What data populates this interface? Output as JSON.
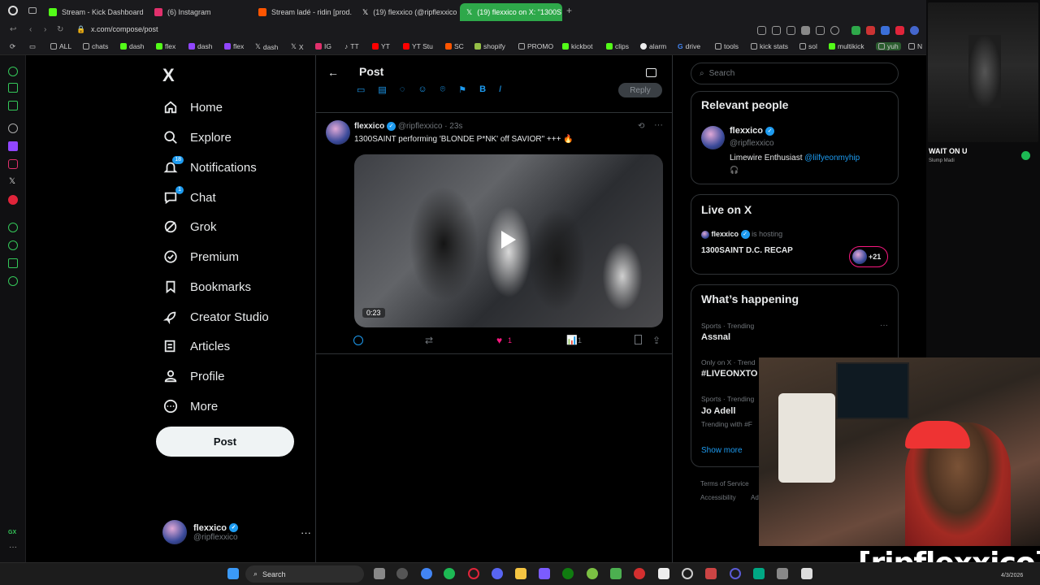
{
  "browser": {
    "tabs": [
      {
        "title": "Stream - Kick Dashboard",
        "favicon_color": "#53fc18",
        "active": false
      },
      {
        "title": "(6) Instagram",
        "favicon_color": "#e1306c",
        "active": false
      },
      {
        "title": "Stream ladé - ridin [prod.",
        "favicon_color": "#ff5500",
        "active": false
      },
      {
        "title": "(19) flexxico (@ripflexxico",
        "favicon_color": "#ffffff",
        "active": false
      },
      {
        "title": "(19) flexxico on X: \"1300S",
        "favicon_color": "#ffffff",
        "active": true
      }
    ],
    "new_tab_label": "+",
    "url": "x.com/compose/post",
    "bookmarks": [
      {
        "label": "ALL",
        "icon": "folder-icon"
      },
      {
        "label": "chats",
        "icon": "folder-icon"
      },
      {
        "label": "dash",
        "icon": "kick-icon"
      },
      {
        "label": "flex",
        "icon": "kick-icon"
      },
      {
        "label": "dash",
        "icon": "twitch-icon"
      },
      {
        "label": "flex",
        "icon": "twitch-icon"
      },
      {
        "label": "dash",
        "icon": "x-icon"
      },
      {
        "label": "X",
        "icon": "x-icon"
      },
      {
        "label": "IG",
        "icon": "instagram-icon"
      },
      {
        "label": "TT",
        "icon": "tiktok-icon"
      },
      {
        "label": "YT",
        "icon": "youtube-icon"
      },
      {
        "label": "YT Stu",
        "icon": "youtube-icon"
      },
      {
        "label": "SC",
        "icon": "soundcloud-icon"
      },
      {
        "label": "shopify",
        "icon": "shopify-icon"
      },
      {
        "label": "PROMO",
        "icon": "folder-icon"
      },
      {
        "label": "kickbot",
        "icon": "bot-icon"
      },
      {
        "label": "clips",
        "icon": "bot-icon"
      },
      {
        "label": "alarm",
        "icon": "alarm-icon"
      },
      {
        "label": "drive",
        "icon": "google-icon"
      },
      {
        "label": "tools",
        "icon": "folder-icon"
      },
      {
        "label": "kick stats",
        "icon": "folder-icon"
      },
      {
        "label": "sol",
        "icon": "folder-icon"
      },
      {
        "label": "multikick",
        "icon": "kick-icon"
      },
      {
        "label": "yuh",
        "icon": "folder-icon"
      },
      {
        "label": "N",
        "icon": "folder-icon"
      }
    ]
  },
  "nav": {
    "logo": "X",
    "items": [
      {
        "label": "Home",
        "icon": "home-icon",
        "badge": ""
      },
      {
        "label": "Explore",
        "icon": "search-icon",
        "badge": ""
      },
      {
        "label": "Notifications",
        "icon": "bell-icon",
        "badge": "18"
      },
      {
        "label": "Chat",
        "icon": "chat-icon",
        "badge": "1"
      },
      {
        "label": "Grok",
        "icon": "grok-icon",
        "badge": ""
      },
      {
        "label": "Premium",
        "icon": "premium-icon",
        "badge": ""
      },
      {
        "label": "Bookmarks",
        "icon": "bookmark-icon",
        "badge": ""
      },
      {
        "label": "Creator Studio",
        "icon": "rocket-icon",
        "badge": ""
      },
      {
        "label": "Articles",
        "icon": "article-icon",
        "badge": ""
      },
      {
        "label": "Profile",
        "icon": "person-icon",
        "badge": ""
      },
      {
        "label": "More",
        "icon": "more-circle-icon",
        "badge": ""
      }
    ],
    "post_button": "Post",
    "account": {
      "name": "flexxico",
      "handle": "@ripflexxico",
      "more": "···"
    }
  },
  "post_page": {
    "title": "Post",
    "reply_button": "Reply",
    "tweet": {
      "name": "flexxico",
      "handle": "@ripflexxico",
      "time": "· 23s",
      "text": "1300SAINT performing 'BLONDE P*NK' off SAVIOR\" +++ 🔥",
      "video_duration": "0:23",
      "likes": "1",
      "views": "1",
      "like_color": "#f91880"
    }
  },
  "sidebar": {
    "search_placeholder": "Search",
    "relevant": {
      "title": "Relevant people",
      "name": "flexxico",
      "handle": "@ripflexxico",
      "bio": "Limewire Enthusiast",
      "bio_link": "@lilfyeonmyhip",
      "bio_extra": "🎧"
    },
    "live": {
      "title": "Live on X",
      "host": "flexxico",
      "hosting_text": "is hosting",
      "space_title": "1300SAINT D.C. RECAP",
      "listeners": "+21"
    },
    "happening": {
      "title": "What’s happening",
      "trends": [
        {
          "meta": "Sports · Trending",
          "name": "Assnal",
          "extra": ""
        },
        {
          "meta": "Only on X · Trend",
          "name": "#LIVEONXTO",
          "extra": ""
        },
        {
          "meta": "Sports · Trending",
          "name": "Jo Adell",
          "extra": "Trending with #F"
        }
      ],
      "show_more": "Show more"
    },
    "footer": [
      "Terms of Service",
      "Accessibility",
      "Ad"
    ]
  },
  "overlay": {
    "song_title": "WAIT ON U",
    "song_artist": "Slump Madi",
    "watermark": "[ripflexxico]"
  },
  "taskbar": {
    "search": "Search",
    "date": "4/3/2026"
  }
}
